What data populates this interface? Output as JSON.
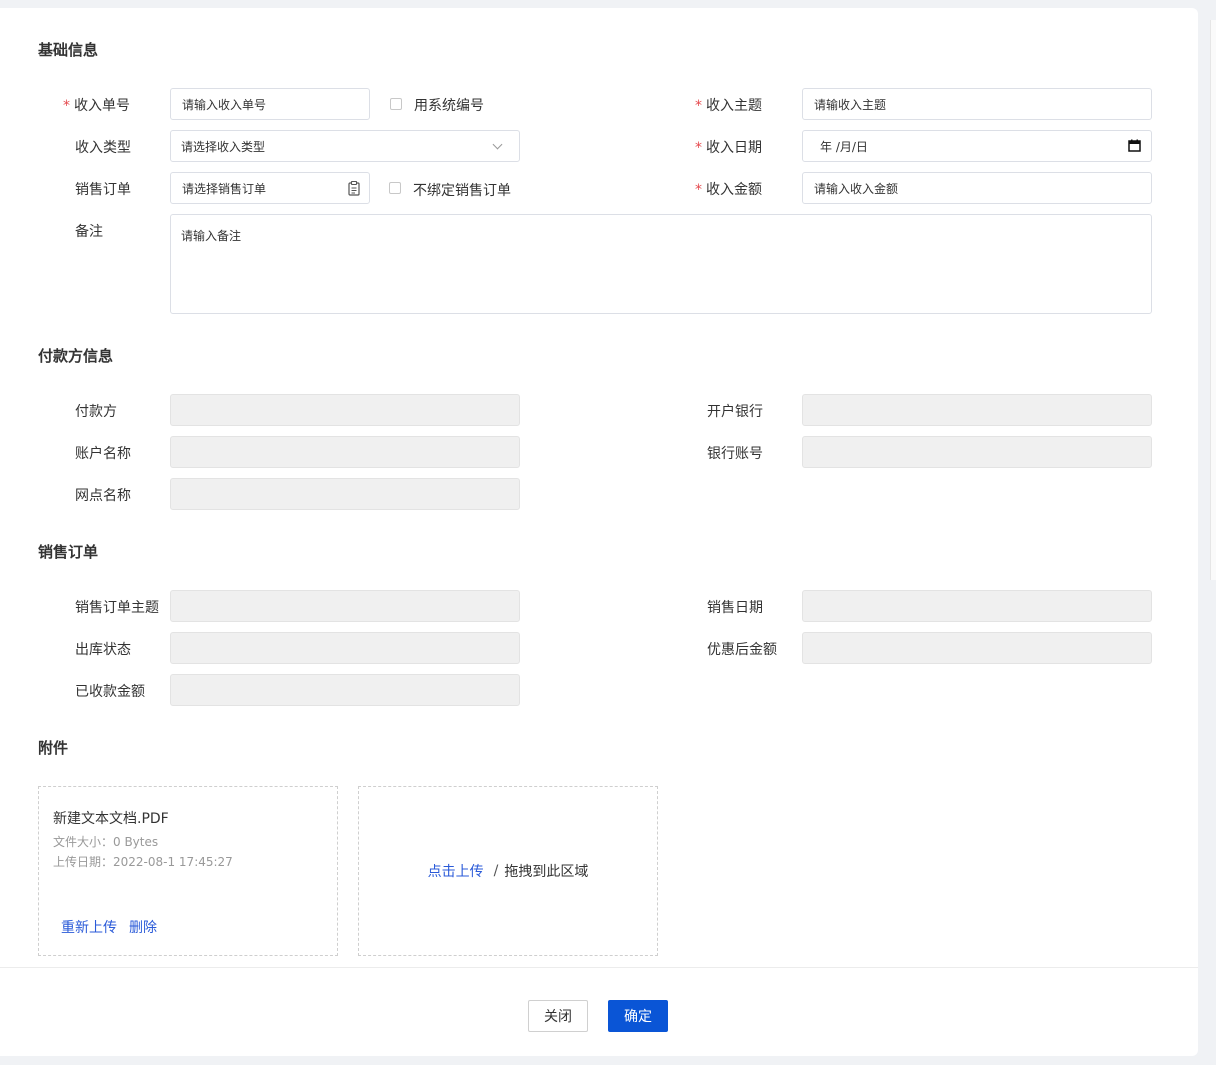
{
  "sections": {
    "basic": "基础信息",
    "payer": "付款方信息",
    "sales_order": "销售订单",
    "attachments": "附件"
  },
  "basic": {
    "income_no": {
      "label": "收入单号",
      "placeholder": "请输入收入单号"
    },
    "use_system_no": "用系统编号",
    "income_subject": {
      "label": "收入主题",
      "placeholder": "请输收入主题"
    },
    "income_type": {
      "label": "收入类型",
      "placeholder": "请选择收入类型"
    },
    "income_date": {
      "label": "收入日期",
      "placeholder": "年 /月/日"
    },
    "sales_order": {
      "label": "销售订单",
      "placeholder": "请选择销售订单"
    },
    "unbind_order": "不绑定销售订单",
    "income_amount": {
      "label": "收入金额",
      "placeholder": "请输入收入金额"
    },
    "remark": {
      "label": "备注",
      "placeholder": "请输入备注"
    },
    "required_mark": "*"
  },
  "payer": {
    "payer_label": "付款方",
    "bank_label": "开户银行",
    "account_name_label": "账户名称",
    "account_no_label": "银行账号",
    "branch_label": "网点名称"
  },
  "order": {
    "subject_label": "销售订单主题",
    "date_label": "销售日期",
    "stock_status_label": "出库状态",
    "discounted_amount_label": "优惠后金额",
    "received_amount_label": "已收款金额"
  },
  "attachment": {
    "file_name": "新建文本文档.PDF",
    "file_size": "文件大小：0 Bytes",
    "upload_date": "上传日期：2022-08-1 17:45:27",
    "reupload": "重新上传",
    "delete": "删除",
    "upload_click": "点击上传",
    "upload_sep": "/",
    "upload_drag": "拖拽到此区域"
  },
  "footer": {
    "close": "关闭",
    "confirm": "确定"
  }
}
